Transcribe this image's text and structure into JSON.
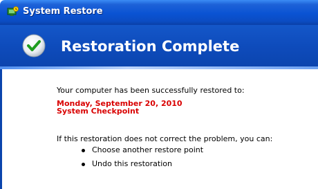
{
  "window": {
    "title": "System Restore",
    "icon": "system-restore-icon"
  },
  "header": {
    "icon": "checkmark-icon",
    "title": "Restoration Complete"
  },
  "content": {
    "intro": "Your computer has been successfully restored to:",
    "restore_date": "Monday, September 20, 2010",
    "restore_point": "System Checkpoint",
    "options_intro": "If this restoration does not correct the problem, you can:",
    "options": [
      "Choose another restore point",
      "Undo this restoration"
    ]
  },
  "colors": {
    "title_bar": "#0a53d3",
    "header_band": "#0e4bbb",
    "highlight_text": "#d90000"
  }
}
